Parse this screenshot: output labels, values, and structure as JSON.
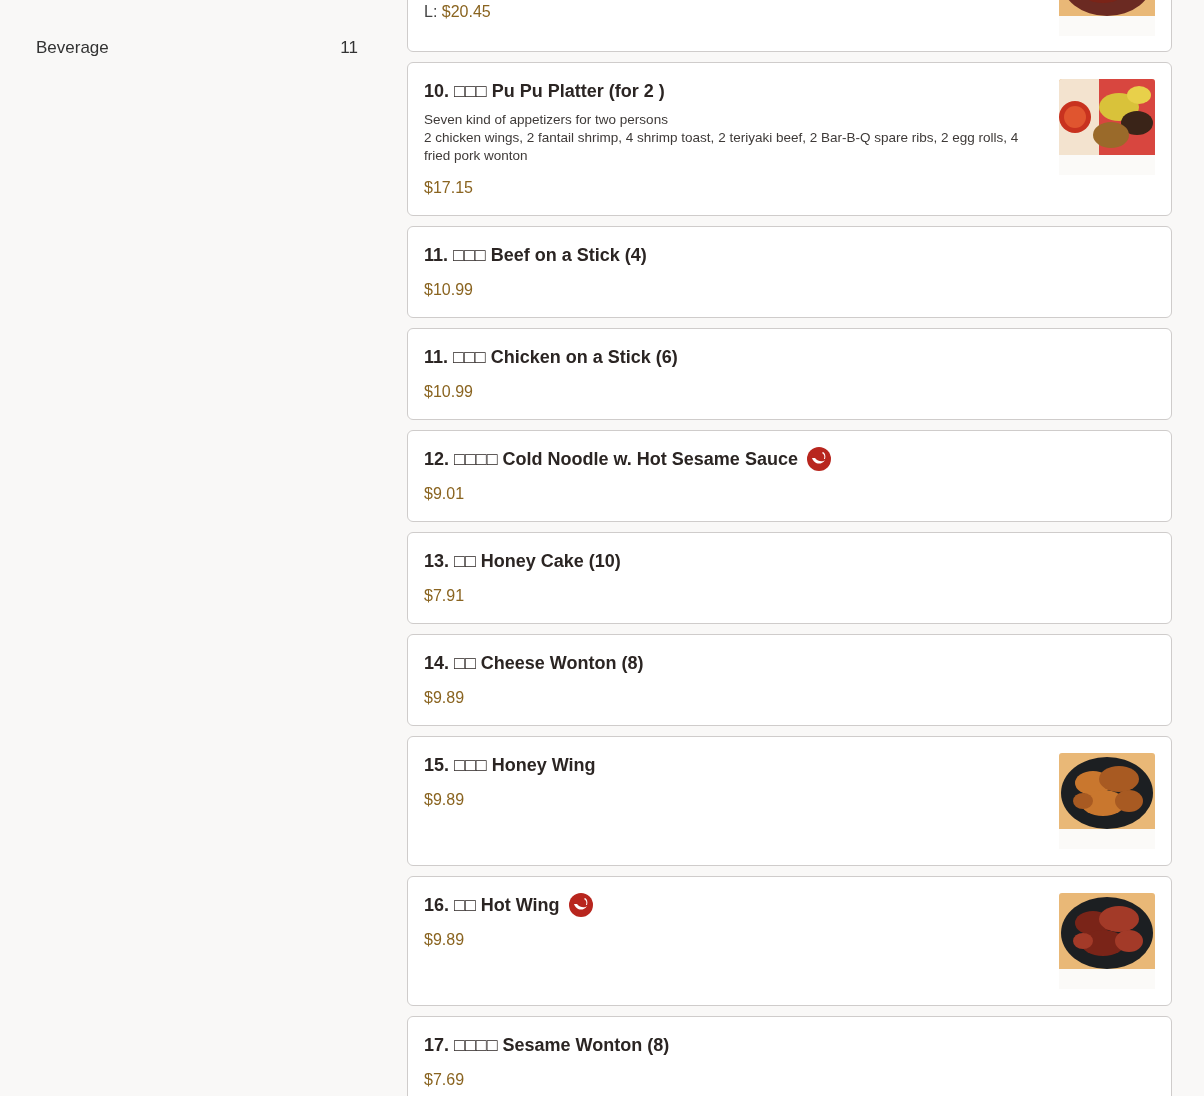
{
  "sidebar": {
    "categories": [
      {
        "name": "Beverage",
        "count": "11"
      }
    ]
  },
  "items": [
    {
      "price_label": "L:",
      "price": "$20.45"
    },
    {
      "title": "10. □□□ Pu Pu Platter (for 2 )",
      "description": [
        "Seven kind of appetizers for two persons",
        "2 chicken wings, 2 fantail shrimp, 4 shrimp toast, 2 teriyaki beef, 2 Bar-B-Q spare ribs, 2 egg rolls, 4 fried pork wonton"
      ],
      "price": "$17.15",
      "spicy": false
    },
    {
      "title": "11. □□□ Beef on a Stick (4)",
      "price": "$10.99",
      "spicy": false
    },
    {
      "title": "11. □□□ Chicken on a Stick (6)",
      "price": "$10.99",
      "spicy": false
    },
    {
      "title": "12. □□□□ Cold Noodle w. Hot Sesame Sauce",
      "price": "$9.01",
      "spicy": true
    },
    {
      "title": "13. □□ Honey Cake (10)",
      "price": "$7.91",
      "spicy": false
    },
    {
      "title": "14. □□ Cheese Wonton (8)",
      "price": "$9.89",
      "spicy": false
    },
    {
      "title": "15. □□□ Honey Wing",
      "price": "$9.89",
      "spicy": false
    },
    {
      "title": "16. □□ Hot Wing",
      "price": "$9.89",
      "spicy": true
    },
    {
      "title": "17. □□□□ Sesame Wonton (8)",
      "price": "$7.69",
      "spicy": false
    }
  ]
}
